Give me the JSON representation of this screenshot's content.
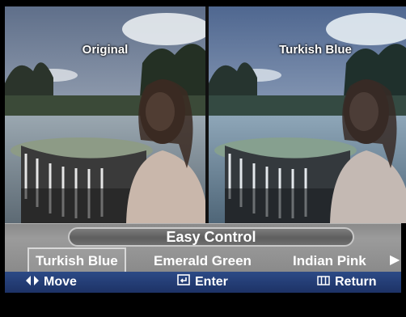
{
  "menu": {
    "title": "Easy Control",
    "options": [
      "Turkish Blue",
      "Emerald Green",
      "Indian Pink"
    ],
    "selected_index": 0
  },
  "previews": {
    "left_label": "Original",
    "right_label": "Turkish Blue"
  },
  "nav": {
    "move": "Move",
    "enter": "Enter",
    "return": "Return"
  },
  "icons": [
    "left-right-arrows-icon",
    "enter-icon",
    "menu-return-icon",
    "next-arrow-icon"
  ],
  "colors": {
    "control_bar": "#8a8a8a",
    "nav_bar": "#2c4a86"
  }
}
